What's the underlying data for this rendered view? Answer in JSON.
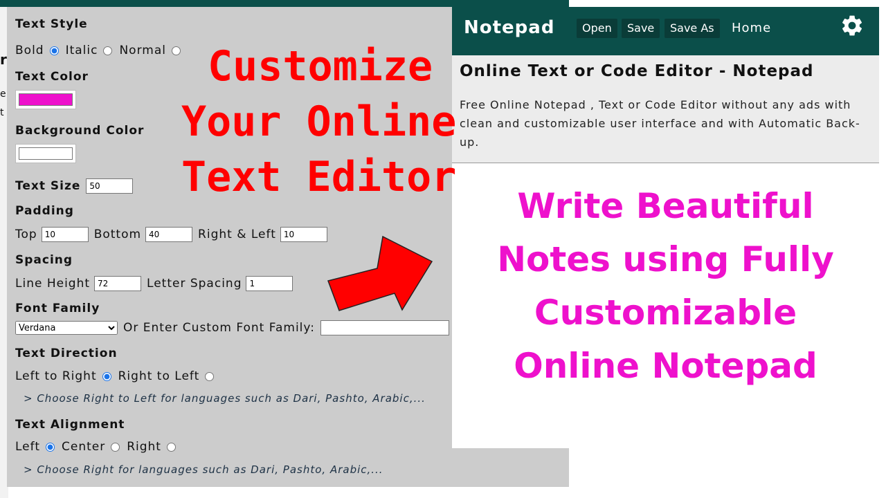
{
  "background": {
    "glyphs": [
      "r",
      "e",
      "t"
    ]
  },
  "settings": {
    "text_style": {
      "title": "Text Style",
      "options": [
        "Bold",
        "Italic",
        "Normal"
      ],
      "selected": "Bold"
    },
    "text_color": {
      "title": "Text Color",
      "value": "#ee11cc"
    },
    "background_color": {
      "title": "Background Color",
      "value": "#ffffff"
    },
    "text_size": {
      "label": "Text Size",
      "value": "50"
    },
    "padding": {
      "title": "Padding",
      "top_label": "Top",
      "top": "10",
      "bottom_label": "Bottom",
      "bottom": "40",
      "rl_label": "Right & Left",
      "rl": "10"
    },
    "spacing": {
      "title": "Spacing",
      "line_height_label": "Line Height",
      "line_height": "72",
      "letter_spacing_label": "Letter Spacing",
      "letter_spacing": "1"
    },
    "font_family": {
      "title": "Font Family",
      "selected": "Verdana",
      "custom_label": "Or Enter Custom Font Family:"
    },
    "text_direction": {
      "title": "Text Direction",
      "options": [
        "Left to Right",
        "Right to Left"
      ],
      "selected": "Left to Right",
      "note": "> Choose Right to Left for languages such as Dari, Pashto, Arabic,..."
    },
    "text_alignment": {
      "title": "Text Alignment",
      "options": [
        "Left",
        "Center",
        "Right"
      ],
      "selected": "Left",
      "note": "> Choose Right for languages such as Dari, Pashto, Arabic,..."
    }
  },
  "headline": [
    "Customize",
    "Your Online",
    "Text Editor"
  ],
  "notepad": {
    "brand": "Notepad",
    "buttons": [
      "Open",
      "Save",
      "Save As"
    ],
    "home": "Home",
    "title": "Online Text or Code Editor - Notepad",
    "description": "Free Online Notepad , Text or Code Editor without any ads with clean and customizable user interface and with Automatic Back-up.",
    "content": [
      "Write Beautiful",
      "Notes using Fully",
      "Customizable",
      "Online Notepad"
    ]
  },
  "colors": {
    "header": "#0b4f4a",
    "accent_red": "#ff0000",
    "text_magenta": "#ee11cc"
  }
}
